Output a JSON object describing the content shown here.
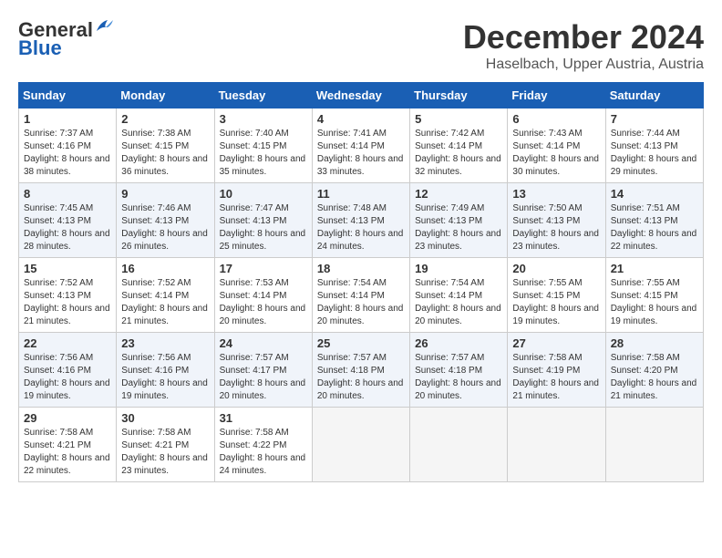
{
  "header": {
    "logo_general": "General",
    "logo_blue": "Blue",
    "month_year": "December 2024",
    "location": "Haselbach, Upper Austria, Austria"
  },
  "weekdays": [
    "Sunday",
    "Monday",
    "Tuesday",
    "Wednesday",
    "Thursday",
    "Friday",
    "Saturday"
  ],
  "weeks": [
    [
      {
        "day": "1",
        "sunrise": "7:37 AM",
        "sunset": "4:16 PM",
        "daylight": "8 hours and 38 minutes."
      },
      {
        "day": "2",
        "sunrise": "7:38 AM",
        "sunset": "4:15 PM",
        "daylight": "8 hours and 36 minutes."
      },
      {
        "day": "3",
        "sunrise": "7:40 AM",
        "sunset": "4:15 PM",
        "daylight": "8 hours and 35 minutes."
      },
      {
        "day": "4",
        "sunrise": "7:41 AM",
        "sunset": "4:14 PM",
        "daylight": "8 hours and 33 minutes."
      },
      {
        "day": "5",
        "sunrise": "7:42 AM",
        "sunset": "4:14 PM",
        "daylight": "8 hours and 32 minutes."
      },
      {
        "day": "6",
        "sunrise": "7:43 AM",
        "sunset": "4:14 PM",
        "daylight": "8 hours and 30 minutes."
      },
      {
        "day": "7",
        "sunrise": "7:44 AM",
        "sunset": "4:13 PM",
        "daylight": "8 hours and 29 minutes."
      }
    ],
    [
      {
        "day": "8",
        "sunrise": "7:45 AM",
        "sunset": "4:13 PM",
        "daylight": "8 hours and 28 minutes."
      },
      {
        "day": "9",
        "sunrise": "7:46 AM",
        "sunset": "4:13 PM",
        "daylight": "8 hours and 26 minutes."
      },
      {
        "day": "10",
        "sunrise": "7:47 AM",
        "sunset": "4:13 PM",
        "daylight": "8 hours and 25 minutes."
      },
      {
        "day": "11",
        "sunrise": "7:48 AM",
        "sunset": "4:13 PM",
        "daylight": "8 hours and 24 minutes."
      },
      {
        "day": "12",
        "sunrise": "7:49 AM",
        "sunset": "4:13 PM",
        "daylight": "8 hours and 23 minutes."
      },
      {
        "day": "13",
        "sunrise": "7:50 AM",
        "sunset": "4:13 PM",
        "daylight": "8 hours and 23 minutes."
      },
      {
        "day": "14",
        "sunrise": "7:51 AM",
        "sunset": "4:13 PM",
        "daylight": "8 hours and 22 minutes."
      }
    ],
    [
      {
        "day": "15",
        "sunrise": "7:52 AM",
        "sunset": "4:13 PM",
        "daylight": "8 hours and 21 minutes."
      },
      {
        "day": "16",
        "sunrise": "7:52 AM",
        "sunset": "4:14 PM",
        "daylight": "8 hours and 21 minutes."
      },
      {
        "day": "17",
        "sunrise": "7:53 AM",
        "sunset": "4:14 PM",
        "daylight": "8 hours and 20 minutes."
      },
      {
        "day": "18",
        "sunrise": "7:54 AM",
        "sunset": "4:14 PM",
        "daylight": "8 hours and 20 minutes."
      },
      {
        "day": "19",
        "sunrise": "7:54 AM",
        "sunset": "4:14 PM",
        "daylight": "8 hours and 20 minutes."
      },
      {
        "day": "20",
        "sunrise": "7:55 AM",
        "sunset": "4:15 PM",
        "daylight": "8 hours and 19 minutes."
      },
      {
        "day": "21",
        "sunrise": "7:55 AM",
        "sunset": "4:15 PM",
        "daylight": "8 hours and 19 minutes."
      }
    ],
    [
      {
        "day": "22",
        "sunrise": "7:56 AM",
        "sunset": "4:16 PM",
        "daylight": "8 hours and 19 minutes."
      },
      {
        "day": "23",
        "sunrise": "7:56 AM",
        "sunset": "4:16 PM",
        "daylight": "8 hours and 19 minutes."
      },
      {
        "day": "24",
        "sunrise": "7:57 AM",
        "sunset": "4:17 PM",
        "daylight": "8 hours and 20 minutes."
      },
      {
        "day": "25",
        "sunrise": "7:57 AM",
        "sunset": "4:18 PM",
        "daylight": "8 hours and 20 minutes."
      },
      {
        "day": "26",
        "sunrise": "7:57 AM",
        "sunset": "4:18 PM",
        "daylight": "8 hours and 20 minutes."
      },
      {
        "day": "27",
        "sunrise": "7:58 AM",
        "sunset": "4:19 PM",
        "daylight": "8 hours and 21 minutes."
      },
      {
        "day": "28",
        "sunrise": "7:58 AM",
        "sunset": "4:20 PM",
        "daylight": "8 hours and 21 minutes."
      }
    ],
    [
      {
        "day": "29",
        "sunrise": "7:58 AM",
        "sunset": "4:21 PM",
        "daylight": "8 hours and 22 minutes."
      },
      {
        "day": "30",
        "sunrise": "7:58 AM",
        "sunset": "4:21 PM",
        "daylight": "8 hours and 23 minutes."
      },
      {
        "day": "31",
        "sunrise": "7:58 AM",
        "sunset": "4:22 PM",
        "daylight": "8 hours and 24 minutes."
      },
      null,
      null,
      null,
      null
    ]
  ],
  "labels": {
    "sunrise": "Sunrise:",
    "sunset": "Sunset:",
    "daylight": "Daylight:"
  }
}
